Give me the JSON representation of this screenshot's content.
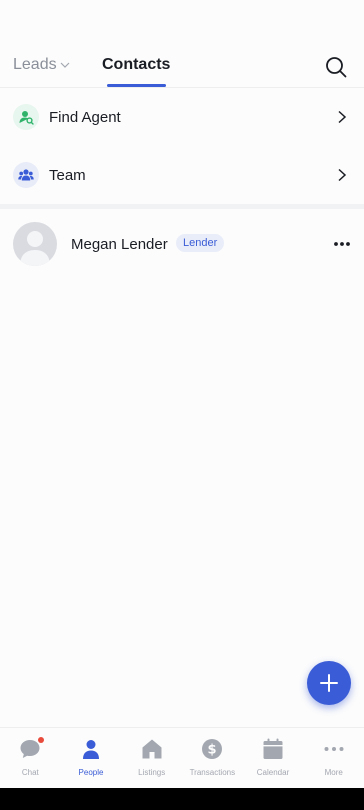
{
  "header": {
    "tabs": [
      {
        "label": "Leads",
        "active": false
      },
      {
        "label": "Contacts",
        "active": true
      }
    ]
  },
  "menu_rows": [
    {
      "label": "Find Agent",
      "icon": "find-agent-icon"
    },
    {
      "label": "Team",
      "icon": "team-icon"
    }
  ],
  "contacts": [
    {
      "name": "Megan Lender",
      "badge": "Lender"
    }
  ],
  "bottom_nav": {
    "items": [
      {
        "label": "Chat",
        "icon": "chat-icon",
        "active": false
      },
      {
        "label": "People",
        "icon": "people-icon",
        "active": true
      },
      {
        "label": "Listings",
        "icon": "listings-icon",
        "active": false
      },
      {
        "label": "Transactions",
        "icon": "transactions-icon",
        "active": false
      },
      {
        "label": "Calendar",
        "icon": "calendar-icon",
        "active": false
      },
      {
        "label": "More",
        "icon": "more-icon",
        "active": false
      }
    ]
  },
  "colors": {
    "accent": "#3a5cd6",
    "inactive": "#a3a7b0",
    "notification": "#e84b3c",
    "green": "#2fb36b"
  }
}
